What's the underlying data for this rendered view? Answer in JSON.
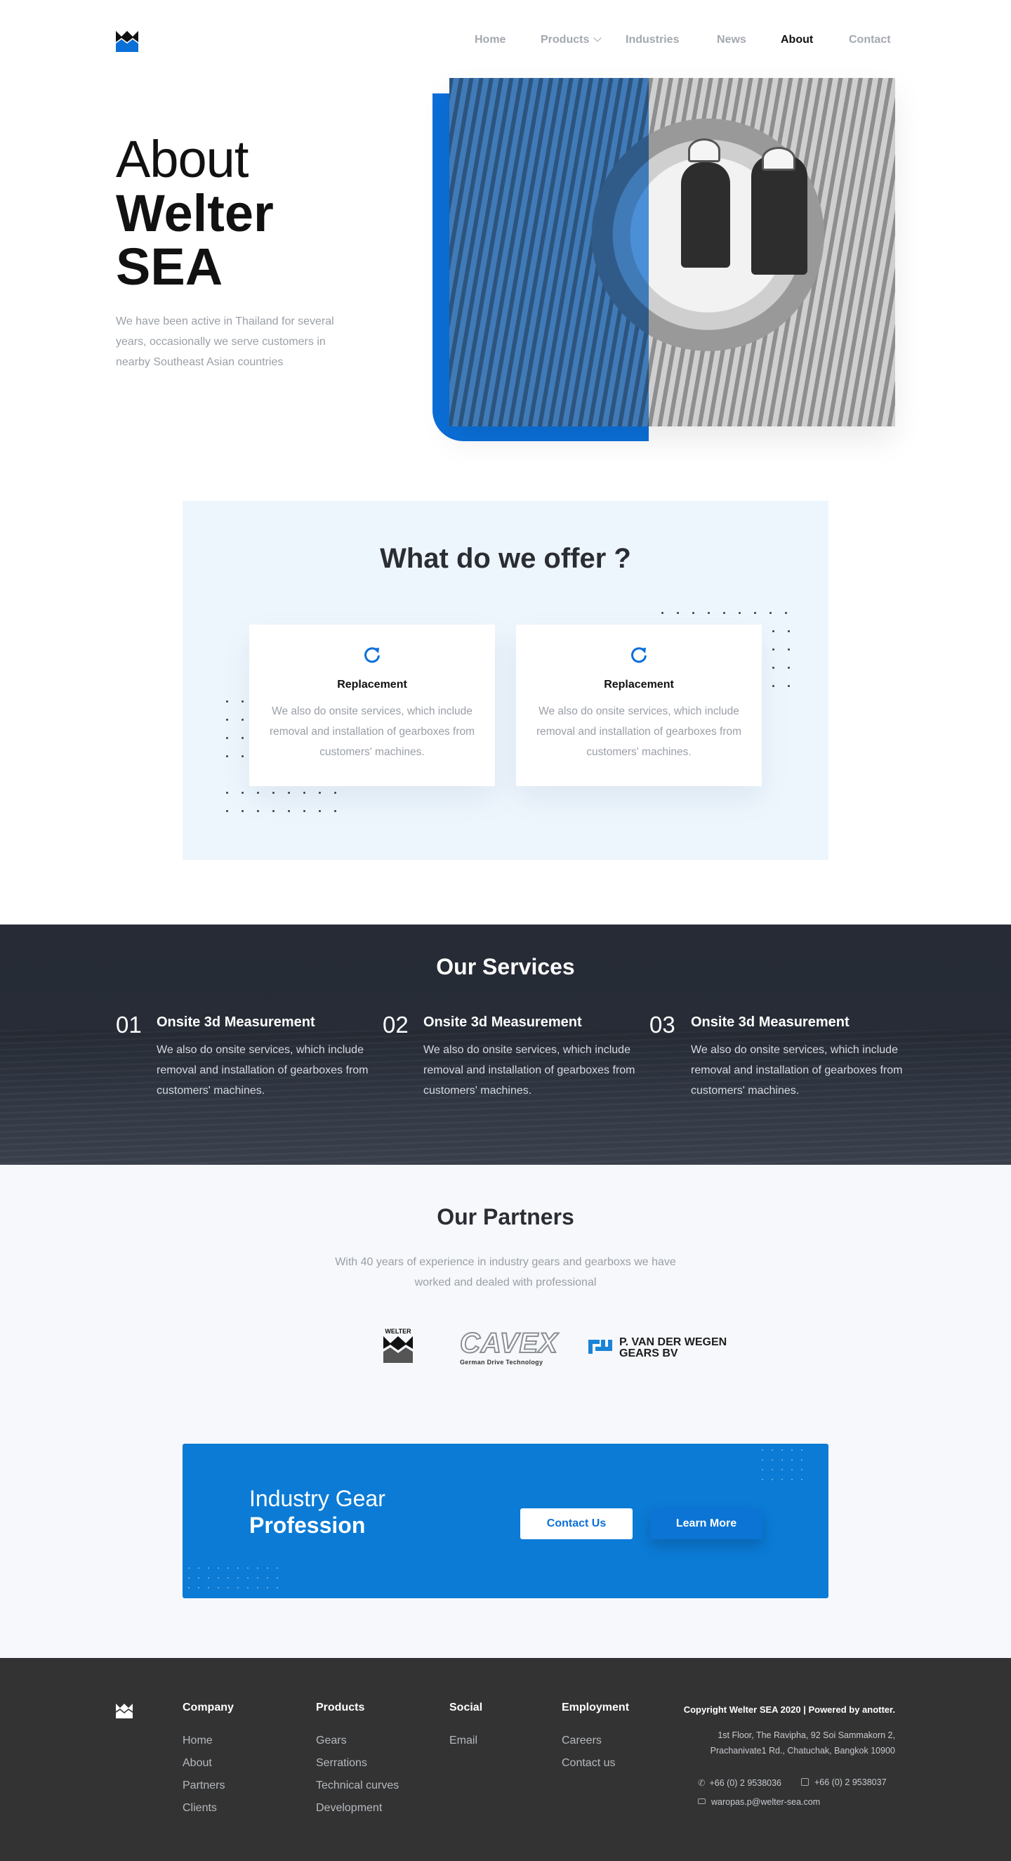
{
  "nav": {
    "items": [
      {
        "label": "Home"
      },
      {
        "label": "Products"
      },
      {
        "label": "Industries"
      },
      {
        "label": "News"
      },
      {
        "label": "About"
      },
      {
        "label": "Contact"
      }
    ]
  },
  "hero": {
    "title_light": "About",
    "title_bold": "Welter SEA",
    "description": "We have been active in Thailand for several years, occasionally we serve customers in nearby Southeast Asian countries"
  },
  "offer": {
    "title": "What do we offer ?",
    "cards": [
      {
        "title": "Replacement",
        "text": "We also do onsite services, which include removal and installation of gearboxes from customers' machines."
      },
      {
        "title": "Replacement",
        "text": "We also do onsite services, which include removal and installation of gearboxes from customers' machines."
      }
    ]
  },
  "services": {
    "title": "Our Services",
    "items": [
      {
        "num": "01",
        "title": "Onsite 3d Measurement",
        "text": "We also do onsite services, which include removal and installation of gearboxes from customers' machines."
      },
      {
        "num": "02",
        "title": "Onsite 3d Measurement",
        "text": "We also do onsite services, which include removal and installation of gearboxes from customers' machines."
      },
      {
        "num": "03",
        "title": "Onsite 3d Measurement",
        "text": "We also do onsite services, which include removal and installation of gearboxes from customers' machines."
      }
    ]
  },
  "partners": {
    "title": "Our Partners",
    "description": "With 40 years  of experience in industry gears and gearboxs we have worked and dealed with professional",
    "logos": [
      {
        "name": "WELTER"
      },
      {
        "name": "CAVEX",
        "tagline": "German Drive Technology"
      },
      {
        "name": "P. VAN DER WEGEN",
        "line2": "GEARS BV"
      }
    ]
  },
  "cta": {
    "title_light": "Industry Gear",
    "title_bold": "Profession",
    "contact_label": "Contact Us",
    "learn_label": "Learn More"
  },
  "footer": {
    "columns": [
      {
        "head": "Company",
        "links": [
          "Home",
          "About",
          "Partners",
          "Clients"
        ]
      },
      {
        "head": "Products",
        "links": [
          "Gears",
          "Serrations",
          "Technical curves",
          "Development"
        ]
      },
      {
        "head": "Social",
        "links": [
          "Email"
        ]
      },
      {
        "head": "Employment",
        "links": [
          "Careers",
          "Contact us"
        ]
      }
    ],
    "copyright": "Copyright Welter SEA 2020 | Powered by anotter.",
    "address_line1": "1st Floor, The Ravipha, 92 Soi Sammakorn 2,",
    "address_line2": "Prachanivate1 Rd., Chatuchak, Bangkok 10900",
    "phone": "+66 (0) 2 9538036",
    "fax": "+66 (0) 2 9538037",
    "email": "waropas.p@welter-sea.com"
  },
  "colors": {
    "brand_blue": "#0b6fd8",
    "dark": "#262b35",
    "footer": "#333333"
  }
}
